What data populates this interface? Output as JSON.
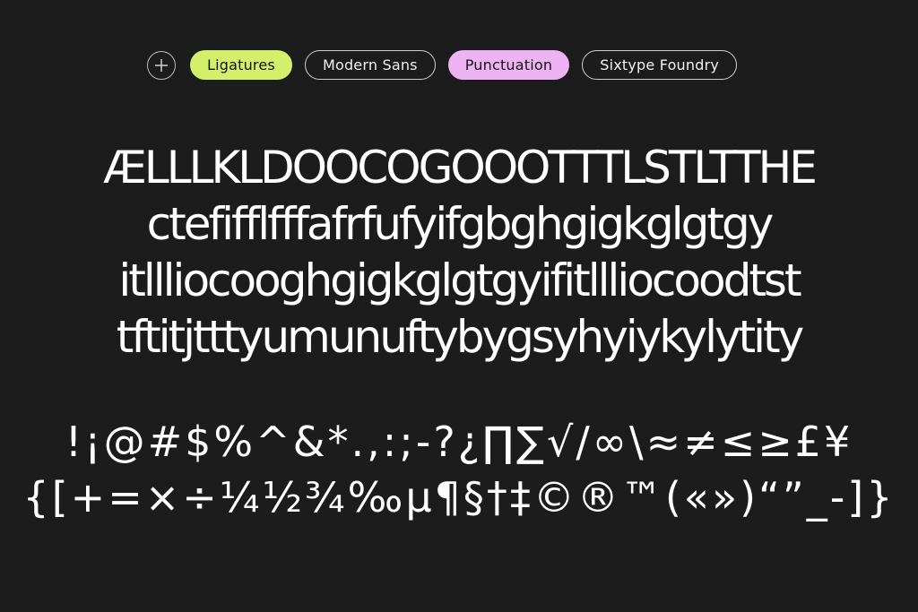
{
  "colors": {
    "background": "#1c1c1c",
    "tag_green": "#d4ef6a",
    "tag_pink": "#eeb3f2",
    "text": "#ffffff"
  },
  "tags": {
    "add_icon": "plus-icon",
    "ligatures": "Ligatures",
    "modern_sans": "Modern Sans",
    "punctuation": "Punctuation",
    "foundry": "Sixtype Foundry"
  },
  "specimen": {
    "ligature_lines": [
      "ÆLLLKLDOOCOGOOOTTTLSTLTTHE",
      "ctefifflfffafrfufyifgbghgigkglgtgy",
      "itllliocooghgigkglgtgyifitllliocoodtst",
      "tftitjtttyumunuftybygsyhyiykylytity"
    ],
    "punctuation_lines": [
      "!¡@#$%^&*.,:;-?¿∏∑√/∞\\≈≠≤≥£¥",
      "{[+=×÷¼½¾‰µ¶§†‡©®™(«»)“”_-]}"
    ]
  }
}
